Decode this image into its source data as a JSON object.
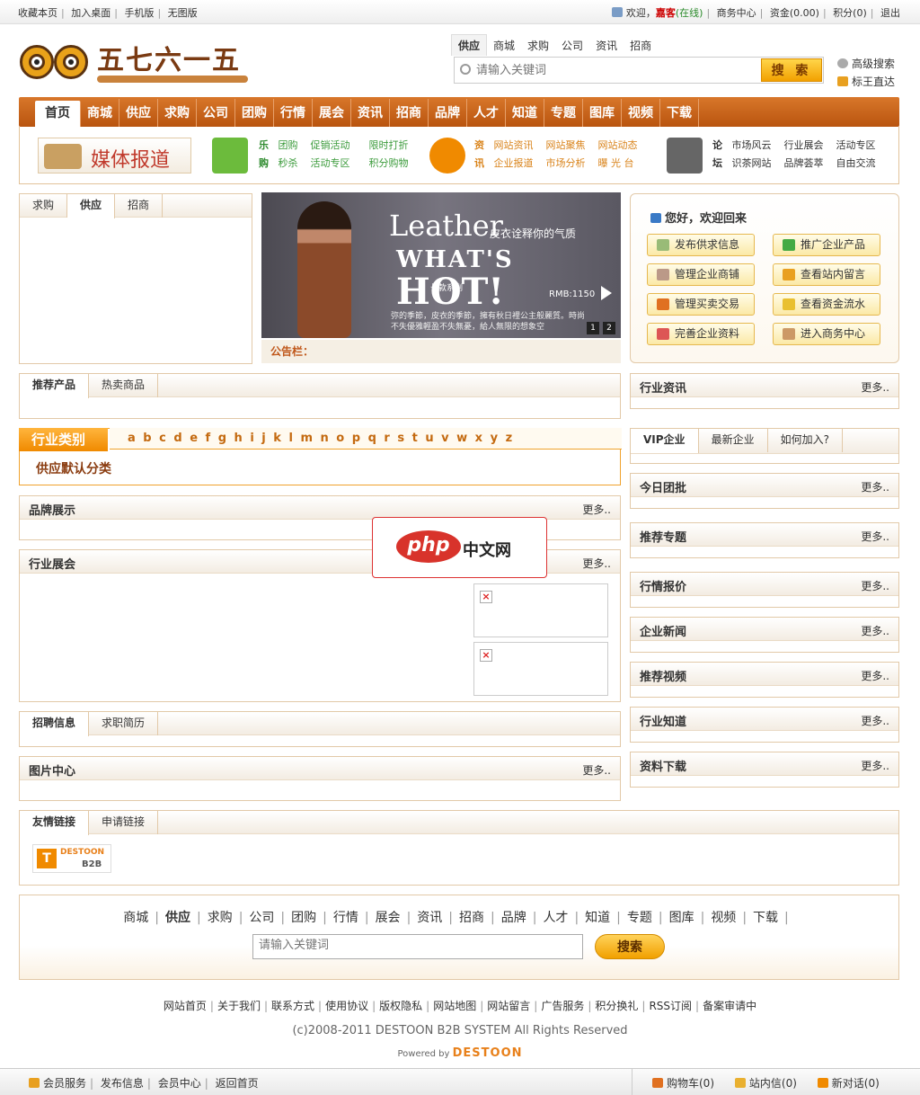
{
  "topbar": {
    "left_links": [
      "收藏本页",
      "加入桌面",
      "手机版",
      "无图版"
    ],
    "welcome": "欢迎，",
    "user": "嘉客",
    "status": "(在线)",
    "right_links": [
      "商务中心",
      "资金(0.00)",
      "积分(0)",
      "退出"
    ]
  },
  "logo": {
    "text": "五七六一五"
  },
  "search": {
    "tabs": [
      "供应",
      "商城",
      "求购",
      "公司",
      "资讯",
      "招商"
    ],
    "placeholder": "请输入关键词",
    "button": "搜 索",
    "advanced": "高级搜索",
    "bid": "标王直达"
  },
  "nav": {
    "items": [
      "首页",
      "商城",
      "供应",
      "求购",
      "公司",
      "团购",
      "行情",
      "展会",
      "资讯",
      "招商",
      "品牌",
      "人才",
      "知道",
      "专题",
      "图库",
      "视频",
      "下载"
    ]
  },
  "subnav": {
    "media": "媒体报道",
    "shop": {
      "head1": "乐",
      "head2": "购",
      "row1": [
        "团购",
        "促销活动",
        "限时打折"
      ],
      "row2": [
        "秒杀",
        "活动专区",
        "积分购物"
      ]
    },
    "news": {
      "head1": "资",
      "head2": "讯",
      "row1": [
        "网站资讯",
        "网站聚焦",
        "网站动态"
      ],
      "row2": [
        "企业报道",
        "市场分析",
        "曝 光 台"
      ]
    },
    "forum": {
      "head1": "论",
      "head2": "坛",
      "row1": [
        "市场风云",
        "行业展会",
        "活动专区"
      ],
      "row2": [
        "识茶网站",
        "品牌荟萃",
        "自由交流"
      ]
    }
  },
  "trade_tabs": [
    "求购",
    "供应",
    "招商"
  ],
  "banner": {
    "t1": "Leather",
    "t2": "皮衣诠释你的气质",
    "t3": "WHAT'S",
    "t4": "HOT!",
    "t5": "RMB:1150",
    "tag": "长款系列",
    "t6": "弥的季節，皮衣的季節，擁有秋日裡公主般麗質。時尚不失優雅輕盈不失無憂，給人無限的想象空",
    "n1": "1",
    "n2": "2"
  },
  "notice": "公告栏：",
  "welcome": {
    "hi": "您好，欢迎回来",
    "buttons": [
      "发布供求信息",
      "推广企业产品",
      "管理企业商铺",
      "查看站内留言",
      "管理买卖交易",
      "查看资金流水",
      "完善企业资料",
      "进入商务中心"
    ]
  },
  "products": {
    "tabs": [
      "推荐产品",
      "热卖商品"
    ]
  },
  "category": {
    "label": "行业类别",
    "letters": "a b c d e f g h i j k l m n o p q r s t u v w x y z",
    "default": "供应默认分类"
  },
  "brand": {
    "title": "品牌展示",
    "more": "更多.."
  },
  "expo": {
    "title": "行业展会",
    "more": "更多..",
    "broken": "×"
  },
  "jobs": {
    "tabs": [
      "招聘信息",
      "求职简历"
    ]
  },
  "photos": {
    "title": "图片中心",
    "more": "更多.."
  },
  "friends": {
    "tabs": [
      "友情链接",
      "申请链接"
    ],
    "logo_top": "DESTOON",
    "logo_bottom": "B2B"
  },
  "right": {
    "news": {
      "title": "行业资讯",
      "more": "更多.."
    },
    "vip_tabs": [
      "VIP企业",
      "最新企业",
      "如何加入?"
    ],
    "boxes": [
      {
        "title": "今日团批",
        "more": "更多.."
      },
      {
        "title": "推荐专题",
        "more": "更多.."
      },
      {
        "title": "行情报价",
        "more": "更多.."
      },
      {
        "title": "企业新闻",
        "more": "更多.."
      },
      {
        "title": "推荐视频",
        "more": "更多.."
      },
      {
        "title": "行业知道",
        "more": "更多.."
      },
      {
        "title": "资料下载",
        "more": "更多.."
      }
    ]
  },
  "overlay": {
    "php": "php",
    "cn": "中文网"
  },
  "footer": {
    "nav": [
      "商城",
      "供应",
      "求购",
      "公司",
      "团购",
      "行情",
      "展会",
      "资讯",
      "招商",
      "品牌",
      "人才",
      "知道",
      "专题",
      "图库",
      "视频",
      "下载"
    ],
    "placeholder": "请输入关键词",
    "button": "搜索",
    "links": [
      "网站首页",
      "关于我们",
      "联系方式",
      "使用协议",
      "版权隐私",
      "网站地图",
      "网站留言",
      "广告服务",
      "积分换礼",
      "RSS订阅",
      "备案审请中"
    ],
    "copyright": "(c)2008-2011 DESTOON B2B SYSTEM All Rights Reserved",
    "powered": "Powered by",
    "powered_brand": "DESTOON"
  },
  "bottombar": {
    "left": [
      "会员服务",
      "发布信息",
      "会员中心",
      "返回首页"
    ],
    "cart": "购物车(0)",
    "mail": "站内信(0)",
    "chat": "新对话(0)"
  },
  "colors": {
    "nav": "#c4621a",
    "accent": "#f08a00",
    "border": "#e2c9a8"
  }
}
